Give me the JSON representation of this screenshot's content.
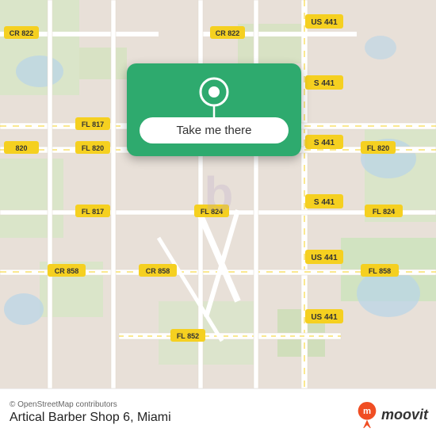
{
  "map": {
    "attribution": "© OpenStreetMap contributors",
    "watermark": "b",
    "bg_color": "#e8e0d8"
  },
  "card": {
    "button_label": "Take me there",
    "pin_icon": "map-pin"
  },
  "bottom_bar": {
    "attribution": "© OpenStreetMap contributors",
    "place_name": "Artical Barber Shop 6, Miami",
    "moovit_label": "moovit"
  },
  "roads": {
    "color_major": "#ffffff",
    "color_yellow": "#f5d020",
    "color_green": "#4caf50",
    "color_minor": "#f0ece4"
  }
}
